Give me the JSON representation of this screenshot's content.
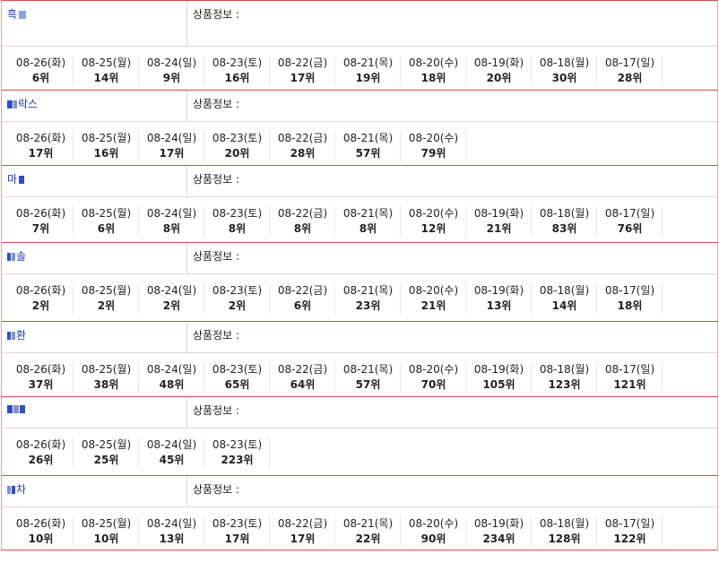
{
  "info_label": "상품정보 :",
  "rank_suffix": "위",
  "products": [
    {
      "name": "흑",
      "ranks": [
        [
          "08-26(화)",
          "6"
        ],
        [
          "08-25(월)",
          "14"
        ],
        [
          "08-24(일)",
          "9"
        ],
        [
          "08-23(토)",
          "16"
        ],
        [
          "08-22(금)",
          "17"
        ],
        [
          "08-21(목)",
          "19"
        ],
        [
          "08-20(수)",
          "18"
        ],
        [
          "08-19(화)",
          "20"
        ],
        [
          "08-18(월)",
          "30"
        ],
        [
          "08-17(일)",
          "28"
        ]
      ]
    },
    {
      "name": "락스",
      "ranks": [
        [
          "08-26(화)",
          "17"
        ],
        [
          "08-25(월)",
          "16"
        ],
        [
          "08-24(일)",
          "17"
        ],
        [
          "08-23(토)",
          "20"
        ],
        [
          "08-22(금)",
          "28"
        ],
        [
          "08-21(목)",
          "57"
        ],
        [
          "08-20(수)",
          "79"
        ]
      ]
    },
    {
      "name": "마",
      "ranks": [
        [
          "08-26(화)",
          "7"
        ],
        [
          "08-25(월)",
          "6"
        ],
        [
          "08-24(일)",
          "8"
        ],
        [
          "08-23(토)",
          "8"
        ],
        [
          "08-22(금)",
          "8"
        ],
        [
          "08-21(목)",
          "8"
        ],
        [
          "08-20(수)",
          "12"
        ],
        [
          "08-19(화)",
          "21"
        ],
        [
          "08-18(월)",
          "83"
        ],
        [
          "08-17(일)",
          "76"
        ]
      ]
    },
    {
      "name": "솔",
      "ranks": [
        [
          "08-26(화)",
          "2"
        ],
        [
          "08-25(월)",
          "2"
        ],
        [
          "08-24(일)",
          "2"
        ],
        [
          "08-23(토)",
          "2"
        ],
        [
          "08-22(금)",
          "6"
        ],
        [
          "08-21(목)",
          "23"
        ],
        [
          "08-20(수)",
          "21"
        ],
        [
          "08-19(화)",
          "13"
        ],
        [
          "08-18(월)",
          "14"
        ],
        [
          "08-17(일)",
          "18"
        ]
      ]
    },
    {
      "name": "환",
      "ranks": [
        [
          "08-26(화)",
          "37"
        ],
        [
          "08-25(월)",
          "38"
        ],
        [
          "08-24(일)",
          "48"
        ],
        [
          "08-23(토)",
          "65"
        ],
        [
          "08-22(금)",
          "64"
        ],
        [
          "08-21(목)",
          "57"
        ],
        [
          "08-20(수)",
          "70"
        ],
        [
          "08-19(화)",
          "105"
        ],
        [
          "08-18(월)",
          "123"
        ],
        [
          "08-17(일)",
          "121"
        ]
      ]
    },
    {
      "name": "",
      "ranks": [
        [
          "08-26(화)",
          "26"
        ],
        [
          "08-25(월)",
          "25"
        ],
        [
          "08-24(일)",
          "45"
        ],
        [
          "08-23(토)",
          "223"
        ]
      ]
    },
    {
      "name": "차",
      "ranks": [
        [
          "08-26(화)",
          "10"
        ],
        [
          "08-25(월)",
          "10"
        ],
        [
          "08-24(일)",
          "13"
        ],
        [
          "08-23(토)",
          "17"
        ],
        [
          "08-22(금)",
          "17"
        ],
        [
          "08-21(목)",
          "22"
        ],
        [
          "08-20(수)",
          "90"
        ],
        [
          "08-19(화)",
          "234"
        ],
        [
          "08-18(월)",
          "128"
        ],
        [
          "08-17(일)",
          "122"
        ]
      ]
    }
  ]
}
